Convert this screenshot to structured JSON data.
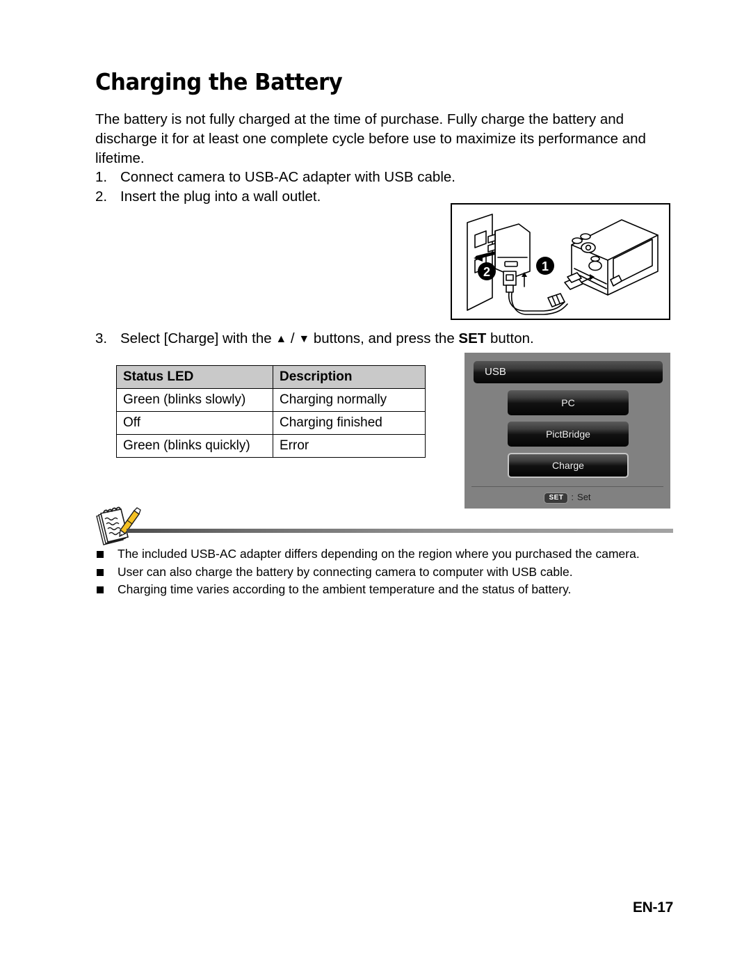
{
  "page": {
    "title": "Charging the Battery",
    "footer_label": "EN-17"
  },
  "intro": {
    "line1": "The battery is not fully charged at the time of purchase. Fully charge the battery and",
    "line2": "discharge it for at least one complete cycle before use to maximize its performance and",
    "line3": "lifetime."
  },
  "steps": [
    {
      "num": "1.",
      "text": "Connect camera to USB-AC adapter with USB cable."
    },
    {
      "num": "2.",
      "text": "Insert the plug into a wall outlet."
    }
  ],
  "step3": {
    "num": "3.",
    "part1": "Select [Charge] with the",
    "up_arrow": "▲",
    "slash": "/",
    "down_arrow": "▼",
    "part2": "buttons, and press the",
    "set_label": "SET",
    "part3": "button."
  },
  "illustration": {
    "callout_1": "❶",
    "callout_2": "❷"
  },
  "status_table": {
    "headers": [
      "Status LED",
      "Description"
    ],
    "rows": [
      [
        "Green (blinks slowly)",
        "Charging normally"
      ],
      [
        "Off",
        "Charging finished"
      ],
      [
        "Green (blinks quickly)",
        "Error"
      ]
    ]
  },
  "lcd": {
    "title": "USB",
    "buttons": [
      {
        "label": "PC",
        "selected": false
      },
      {
        "label": "PictBridge",
        "selected": false
      },
      {
        "label": "Charge",
        "selected": true
      }
    ],
    "footer": {
      "badge": "SET",
      "separator": ":",
      "action": "Set"
    },
    "colors": {
      "panel_bg": "#818181",
      "button_dark": "#050505",
      "selected_border": "#c6c6c6"
    }
  },
  "notes": [
    "The included USB-AC adapter differs depending on the region where you purchased the camera.",
    "User can also charge the battery by connecting camera to computer with USB cable.",
    "Charging time varies according to the ambient temperature and the status of battery."
  ]
}
